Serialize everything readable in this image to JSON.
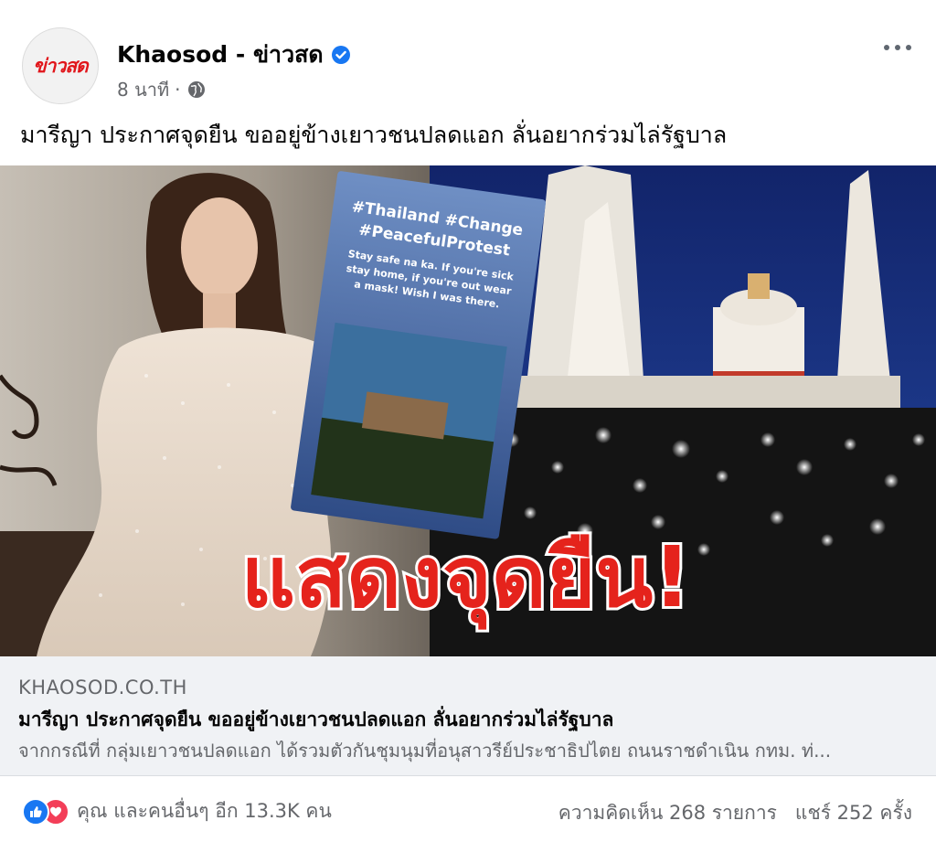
{
  "post": {
    "avatar_text": "ข่าวสด",
    "page_name": "Khaosod - ข่าวสด",
    "time": "8 นาที",
    "separator": "·",
    "caption": "มารีญา ประกาศจุดยืน ขออยู่ข้างเยาวชนปลดแอก ลั่นอยากร่วมไล่รัฐบาล"
  },
  "image": {
    "story_hashtag1": "#Thailand #Change",
    "story_hashtag2": "#PeacefulProtest",
    "story_text1": "Stay safe na ka. If you're sick",
    "story_text2": "stay home, if you're out wear",
    "story_text3": "a mask! Wish I was there.",
    "headline": "แสดงจุดยืน!"
  },
  "link": {
    "domain": "KHAOSOD.CO.TH",
    "title": "มารีญา ประกาศจุดยืน ขออยู่ข้างเยาวชนปลดแอก ลั่นอยากร่วมไล่รัฐบาล",
    "description": "จากกรณีที่ กลุ่มเยาวชนปลดแอก ได้รวมตัวกันชุมนุมที่อนุสาวรีย์ประชาธิปไตย ถนนราชดำเนิน กทม. ท่..."
  },
  "footer": {
    "reactions_text": "คุณ และคนอื่นๆ อีก 13.3K คน",
    "comments": "ความคิดเห็น 268 รายการ",
    "shares": "แชร์ 252 ครั้ง"
  },
  "colors": {
    "accent": "#1877f2",
    "love": "#f33e58",
    "headline_red": "#e5231c",
    "secondary_text": "#65676b"
  },
  "icons": [
    "verified-badge-icon",
    "globe-icon",
    "more-options-icon",
    "like-reaction-icon",
    "love-reaction-icon"
  ]
}
